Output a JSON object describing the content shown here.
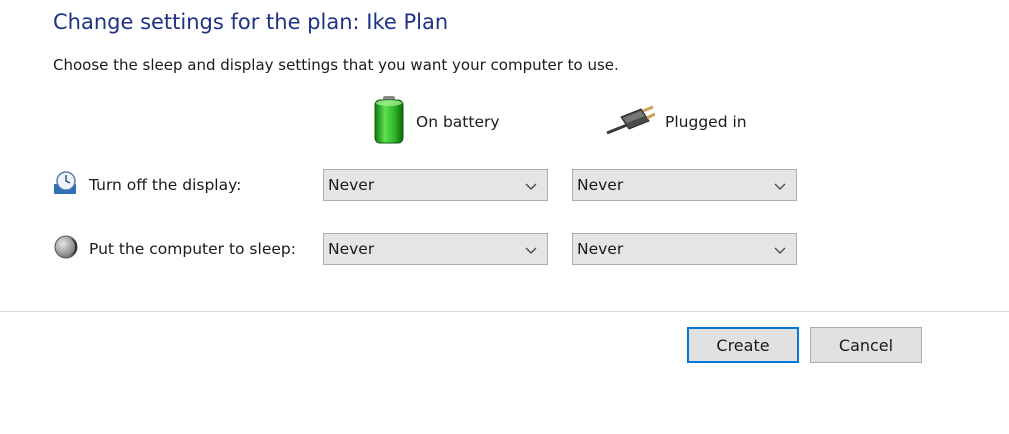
{
  "header": {
    "title": "Change settings for the plan: Ike Plan",
    "subtitle": "Choose the sleep and display settings that you want your computer to use."
  },
  "columns": {
    "battery": {
      "label": "On battery",
      "icon": "battery-icon"
    },
    "plugged": {
      "label": "Plugged in",
      "icon": "power-plug-icon"
    }
  },
  "rows": {
    "display": {
      "label": "Turn off the display:",
      "icon": "display-timer-icon",
      "battery_value": "Never",
      "plugged_value": "Never"
    },
    "sleep": {
      "label": "Put the computer to sleep:",
      "icon": "sleep-moon-icon",
      "battery_value": "Never",
      "plugged_value": "Never"
    }
  },
  "buttons": {
    "create_label": "Create",
    "cancel_label": "Cancel"
  },
  "colors": {
    "title": "#1e3287",
    "focus_border": "#0078d7",
    "battery_green": "#2fb52a"
  }
}
